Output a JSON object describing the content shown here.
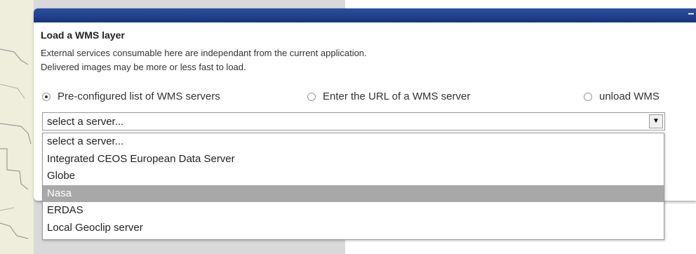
{
  "panel": {
    "title": "Load a WMS layer",
    "desc_line1": "External services consumable here are independant from the current application.",
    "desc_line2": "Delivered images may be more or less fast to load.",
    "minimize_label": "−"
  },
  "radios": [
    {
      "label": "Pre-configured list of WMS servers",
      "checked": true
    },
    {
      "label": "Enter the URL of a WMS server",
      "checked": false
    },
    {
      "label": "unload WMS",
      "checked": false
    }
  ],
  "server_select": {
    "value": "select a server...",
    "options": [
      "select a server...",
      "Integrated CEOS European Data Server",
      "Globe",
      "Nasa",
      "ERDAS",
      "Local Geoclip server"
    ],
    "highlighted": "Nasa"
  },
  "colors": {
    "titlebar": "#1f3f8a",
    "highlight": "#a8a8a8",
    "map_bg": "#d9d9d9"
  }
}
